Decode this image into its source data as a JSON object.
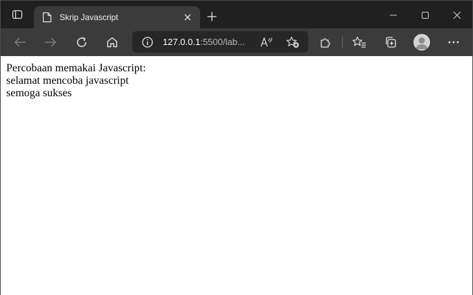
{
  "browser": {
    "tab": {
      "title": "Skrip Javascript",
      "favicon": "page-icon"
    },
    "address": {
      "host": "127.0.0.1",
      "rest": ":5500/lab..."
    },
    "icons": {
      "tab_actions": "tab-actions-icon",
      "close_tab": "close-icon",
      "new_tab": "plus-icon",
      "minimize": "minimize-icon",
      "maximize": "maximize-icon",
      "close_window": "close-icon",
      "back": "back-arrow-icon",
      "forward": "forward-arrow-icon",
      "refresh": "refresh-icon",
      "home": "home-icon",
      "site_info": "info-icon",
      "read_aloud": "read-aloud-icon",
      "add_favorite": "add-favorite-icon",
      "extensions": "puzzle-icon",
      "favorites": "favorites-icon",
      "collections": "collections-icon",
      "profile": "profile-icon",
      "more": "more-icon"
    },
    "colors": {
      "tabstrip": "#202020",
      "toolbar": "#3b3b3b",
      "addressbar": "#262626",
      "page_bg": "#ffffff"
    }
  },
  "page": {
    "lines": [
      "Percobaan memakai Javascript:",
      "selamat mencoba javascript",
      "semoga sukses"
    ]
  }
}
